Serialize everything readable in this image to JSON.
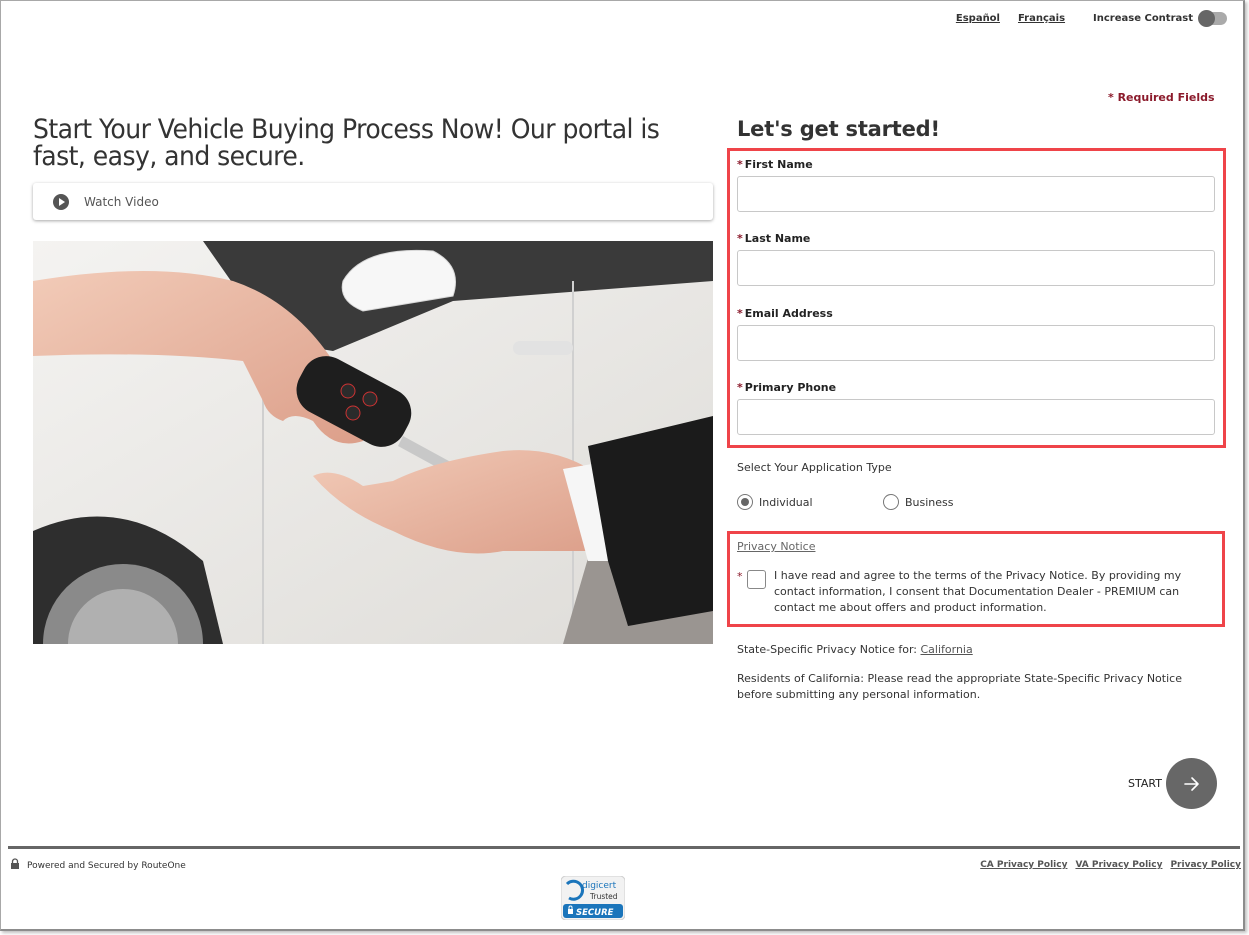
{
  "topbar": {
    "lang_es": "Español",
    "lang_fr": "Français",
    "contrast_label": "Increase Contrast",
    "contrast_on": false
  },
  "required_note": "* Required Fields",
  "left": {
    "headline": "Start Your Vehicle Buying Process Now! Our portal is fast, easy, and secure.",
    "video_label": "Watch Video",
    "photo_alt": "Hand passing car key to another hand in front of white car"
  },
  "form": {
    "title": "Let's get started!",
    "required_marker": "*",
    "fields": [
      {
        "label": "First Name",
        "value": "",
        "placeholder": ""
      },
      {
        "label": "Last Name",
        "value": "",
        "placeholder": ""
      },
      {
        "label": "Email Address",
        "value": "",
        "placeholder": ""
      },
      {
        "label": "Primary Phone",
        "value": "",
        "placeholder": ""
      }
    ],
    "application_type_label": "Select Your Application Type",
    "application_types": [
      {
        "label": "Individual",
        "selected": true
      },
      {
        "label": "Business",
        "selected": false
      }
    ],
    "privacy_link": "Privacy Notice",
    "consent_text": "I have read and agree to the terms of the Privacy Notice. By providing my contact information, I consent that Documentation Dealer - PREMIUM can contact me about offers and product information.",
    "consent_checked": false,
    "state_notice_prefix": "State-Specific Privacy Notice for: ",
    "state_notice_link": "California",
    "residents_text": "Residents of California: Please read the appropriate State-Specific Privacy Notice before submitting any personal information.",
    "start_label": "START"
  },
  "footer": {
    "powered_by": "Powered and Secured by RouteOne",
    "links": [
      "CA Privacy Policy",
      "VA Privacy Policy",
      "Privacy Policy"
    ],
    "badge": {
      "line1": "digicert",
      "line2": "Trusted",
      "line3": "SECURE"
    }
  },
  "colors": {
    "required": "#8b1a2b",
    "highlight": "#ef4449",
    "start_button": "#676767",
    "badge_blue": "#1b75bb"
  }
}
